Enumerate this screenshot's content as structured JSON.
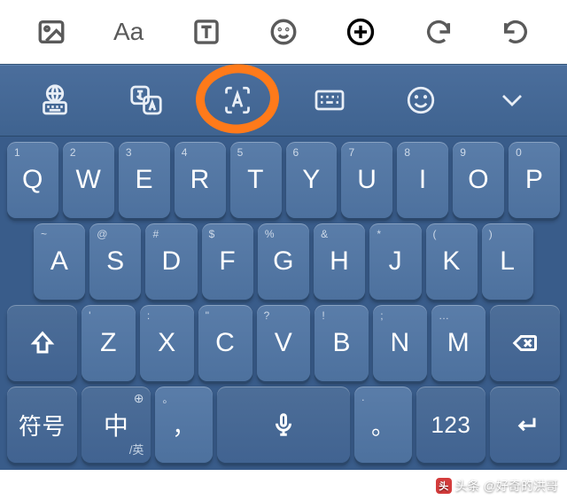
{
  "editor_toolbar": {
    "image": "image-icon",
    "font": "Aa",
    "textbox": "T",
    "emoji": "emoji-icon",
    "add": "add-icon",
    "undo": "undo-icon",
    "redo": "redo-icon"
  },
  "ime_toolbar": {
    "items": [
      "globe-keyboard",
      "translate",
      "ocr-scan",
      "keyboard-switch",
      "emoji",
      "collapse"
    ]
  },
  "keyboard": {
    "row1": [
      {
        "main": "Q",
        "sup": "1"
      },
      {
        "main": "W",
        "sup": "2"
      },
      {
        "main": "E",
        "sup": "3"
      },
      {
        "main": "R",
        "sup": "4"
      },
      {
        "main": "T",
        "sup": "5"
      },
      {
        "main": "Y",
        "sup": "6"
      },
      {
        "main": "U",
        "sup": "7"
      },
      {
        "main": "I",
        "sup": "8"
      },
      {
        "main": "O",
        "sup": "9"
      },
      {
        "main": "P",
        "sup": "0"
      }
    ],
    "row2": [
      {
        "main": "A",
        "sup": "~"
      },
      {
        "main": "S",
        "sup": "@"
      },
      {
        "main": "D",
        "sup": "#"
      },
      {
        "main": "F",
        "sup": "$"
      },
      {
        "main": "G",
        "sup": "%"
      },
      {
        "main": "H",
        "sup": "&"
      },
      {
        "main": "J",
        "sup": "*"
      },
      {
        "main": "K",
        "sup": "("
      },
      {
        "main": "L",
        "sup": ")"
      }
    ],
    "row3": {
      "shift": "shift",
      "keys": [
        {
          "main": "Z",
          "sup": "'"
        },
        {
          "main": "X",
          "sup": ":"
        },
        {
          "main": "C",
          "sup": "\""
        },
        {
          "main": "V",
          "sup": "?"
        },
        {
          "main": "B",
          "sup": "!"
        },
        {
          "main": "N",
          "sup": ";"
        },
        {
          "main": "M",
          "sup": "…"
        }
      ],
      "backspace": "backspace"
    },
    "row4": {
      "symbols": "符号",
      "lang": {
        "main": "中",
        "sub": "/英",
        "corner": "⊕"
      },
      "comma": {
        "main": "，",
        "sup": "。"
      },
      "space": "voice",
      "period": {
        "main": "。",
        "sup": "."
      },
      "numbers": "123",
      "enter": "enter"
    }
  },
  "watermark": {
    "prefix": "头条",
    "author": "@好奇的洪哥"
  }
}
